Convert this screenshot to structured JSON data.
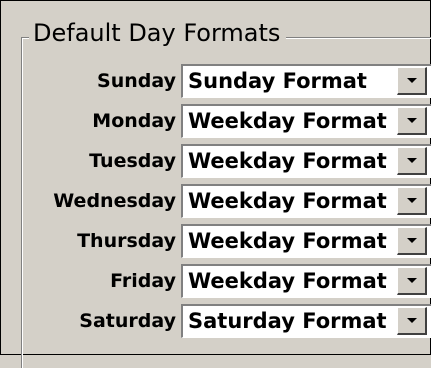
{
  "group": {
    "title": "Default Day Formats"
  },
  "rows": [
    {
      "day": "Sunday",
      "format": "Sunday Format"
    },
    {
      "day": "Monday",
      "format": "Weekday Format"
    },
    {
      "day": "Tuesday",
      "format": "Weekday Format"
    },
    {
      "day": "Wednesday",
      "format": "Weekday Format"
    },
    {
      "day": "Thursday",
      "format": "Weekday Format"
    },
    {
      "day": "Friday",
      "format": "Weekday Format"
    },
    {
      "day": "Saturday",
      "format": "Saturday Format"
    }
  ],
  "icons": {
    "dropdown": "chevron-down-icon"
  }
}
